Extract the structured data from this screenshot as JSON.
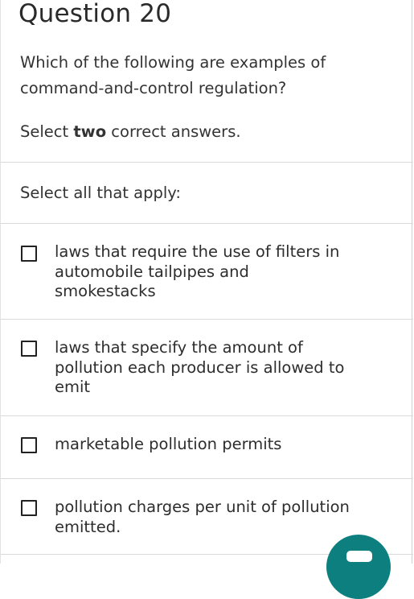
{
  "question": {
    "title": "Question 20",
    "prompt": "Which of the following are examples of command-and-control regulation?",
    "instruction_prefix": "Select ",
    "instruction_count": "two",
    "instruction_suffix": " correct answers.",
    "select_all_label": "Select all that apply:"
  },
  "options": [
    {
      "label": "laws that require the use of filters in automobile tailpipes and smokestacks",
      "checked": false
    },
    {
      "label": "laws that specify the amount of pollution each producer is allowed to emit",
      "checked": false
    },
    {
      "label": "marketable pollution permits",
      "checked": false
    },
    {
      "label": "pollution charges per unit of pollution emitted.",
      "checked": false
    }
  ],
  "chat": {
    "icon": "chat-bubble-icon",
    "color": "#0d7f7f"
  }
}
